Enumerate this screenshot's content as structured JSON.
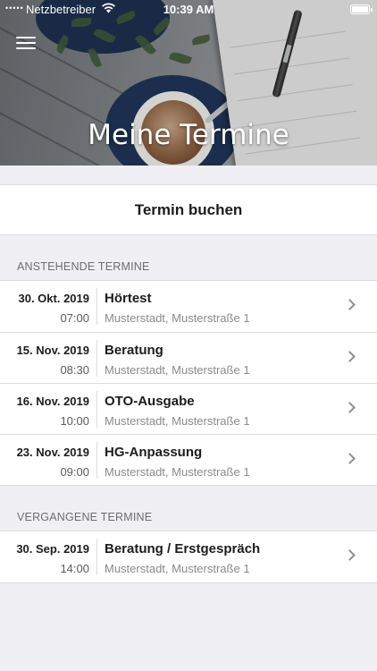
{
  "status_bar": {
    "signal": "•••••",
    "carrier": "Netzbetreiber",
    "time": "10:39 AM"
  },
  "header": {
    "title": "Meine Termine"
  },
  "book_button": {
    "label": "Termin buchen"
  },
  "upcoming": {
    "header": "ANSTEHENDE TERMINE",
    "items": [
      {
        "date": "30. Okt. 2019",
        "time": "07:00",
        "title": "Hörtest",
        "location": "Musterstadt, Musterstraße 1"
      },
      {
        "date": "15. Nov. 2019",
        "time": "08:30",
        "title": "Beratung",
        "location": "Musterstadt, Musterstraße 1"
      },
      {
        "date": "16. Nov. 2019",
        "time": "10:00",
        "title": "OTO-Ausgabe",
        "location": "Musterstadt, Musterstraße 1"
      },
      {
        "date": "23. Nov. 2019",
        "time": "09:00",
        "title": "HG-Anpassung",
        "location": "Musterstadt, Musterstraße 1"
      }
    ]
  },
  "past": {
    "header": "VERGANGENE TERMINE",
    "items": [
      {
        "date": "30. Sep. 2019",
        "time": "14:00",
        "title": "Beratung / Erstgespräch",
        "location": "Musterstadt, Musterstraße 1"
      }
    ]
  },
  "icons": {
    "menu": "hamburger-menu-icon",
    "row_action": "chevron-right-icon",
    "wifi": "wifi-icon",
    "battery": "battery-icon"
  },
  "colors": {
    "background": "#efeff4",
    "card": "#ffffff",
    "secondary_text": "#8a8a8e"
  }
}
